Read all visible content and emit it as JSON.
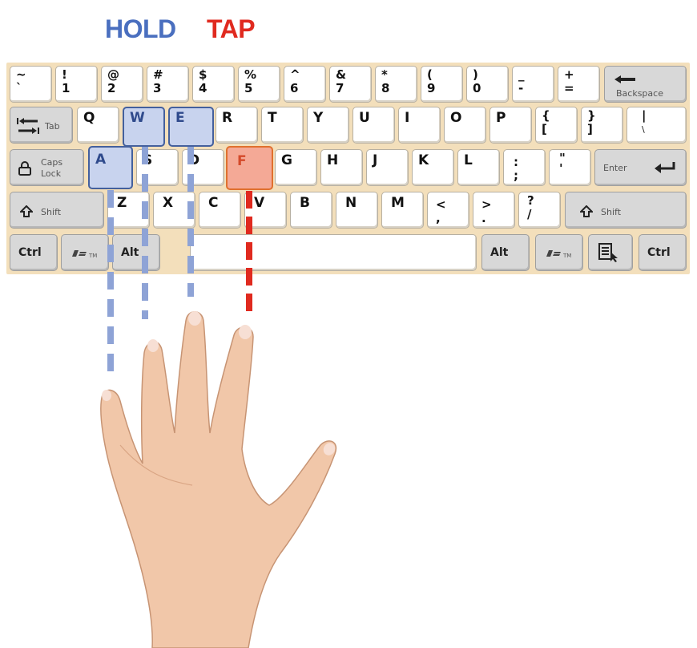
{
  "legend": {
    "hold": "HOLD",
    "tap": "TAP"
  },
  "colors": {
    "hold": "#4a6fbf",
    "tap": "#e02a1f",
    "keyboard_bg": "#f3dfbb"
  },
  "keyboard": {
    "number_row": [
      {
        "top": "~",
        "bottom": "`"
      },
      {
        "top": "!",
        "bottom": "1"
      },
      {
        "top": "@",
        "bottom": "2"
      },
      {
        "top": "#",
        "bottom": "3"
      },
      {
        "top": "$",
        "bottom": "4"
      },
      {
        "top": "%",
        "bottom": "5"
      },
      {
        "top": "^",
        "bottom": "6"
      },
      {
        "top": "&",
        "bottom": "7"
      },
      {
        "top": "*",
        "bottom": "8"
      },
      {
        "top": "(",
        "bottom": "9"
      },
      {
        "top": ")",
        "bottom": "0"
      },
      {
        "top": "_",
        "bottom": "-"
      },
      {
        "top": "+",
        "bottom": "="
      }
    ],
    "backspace": "Backspace",
    "tab": "Tab",
    "qwerty_row": [
      "Q",
      "W",
      "E",
      "R",
      "T",
      "Y",
      "U",
      "I",
      "O",
      "P"
    ],
    "qwerty_sym": [
      {
        "top": "{",
        "bottom": "["
      },
      {
        "top": "}",
        "bottom": "]"
      },
      {
        "top": "|",
        "bottom": "\\"
      }
    ],
    "caps": [
      "Caps",
      "Lock"
    ],
    "home_row": [
      "A",
      "S",
      "D",
      "F",
      "G",
      "H",
      "J",
      "K",
      "L"
    ],
    "home_sym": [
      {
        "top": ":",
        "bottom": ";"
      },
      {
        "top": "\"",
        "bottom": "'"
      }
    ],
    "enter": "Enter",
    "shift": "Shift",
    "bottom_row": [
      "Z",
      "X",
      "C",
      "V",
      "B",
      "N",
      "M"
    ],
    "bottom_sym": [
      {
        "top": "<",
        "bottom": ","
      },
      {
        "top": ">",
        "bottom": "."
      },
      {
        "top": "?",
        "bottom": "/"
      }
    ],
    "ctrl": "Ctrl",
    "alt": "Alt",
    "win_tm": "TM"
  },
  "highlight": {
    "hold_keys": [
      "A",
      "W",
      "E"
    ],
    "tap_keys": [
      "F"
    ]
  }
}
